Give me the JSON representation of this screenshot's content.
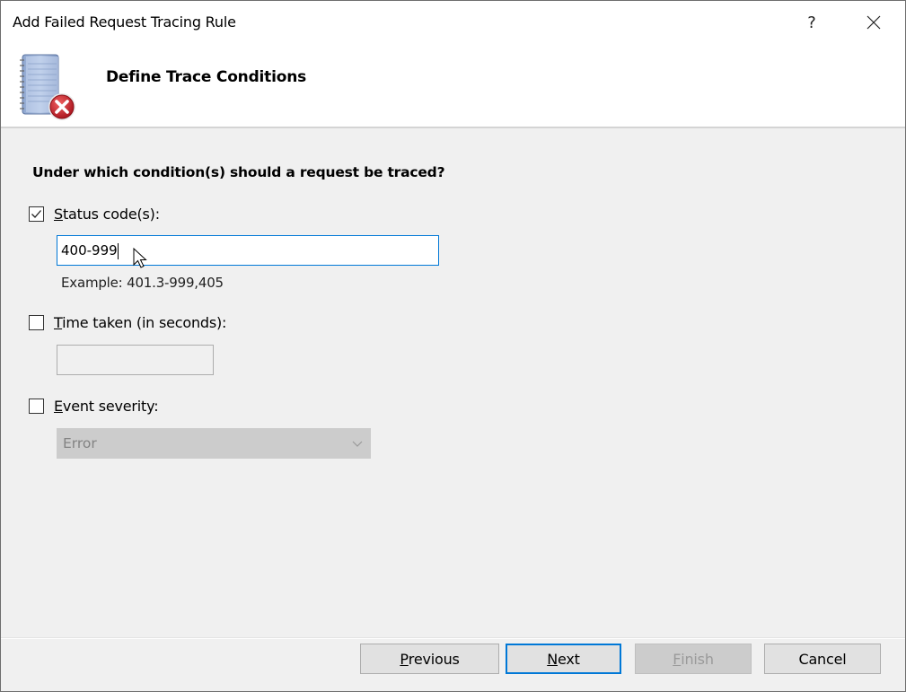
{
  "window": {
    "title": "Add Failed Request Tracing Rule",
    "help_label": "?",
    "close_label": "×"
  },
  "header": {
    "icon": "trace-log-error-icon",
    "title": "Define Trace Conditions"
  },
  "form": {
    "question": "Under which condition(s) should a request be traced?",
    "status_code": {
      "checked": true,
      "label_mnemonic": "S",
      "label_rest": "tatus code(s):",
      "value": "400-999",
      "example": "Example: 401.3-999,405"
    },
    "time_taken": {
      "checked": false,
      "label_mnemonic": "T",
      "label_rest": "ime taken (in seconds):",
      "value": ""
    },
    "event_severity": {
      "checked": false,
      "label_mnemonic": "E",
      "label_rest": "vent severity:",
      "selected": "Error"
    }
  },
  "buttons": {
    "previous": {
      "mnemonic": "P",
      "rest": "revious"
    },
    "next": {
      "mnemonic": "N",
      "rest": "ext"
    },
    "finish": {
      "mnemonic": "F",
      "rest": "inish"
    },
    "cancel": {
      "label": "Cancel"
    }
  },
  "colors": {
    "accent": "#0078d7",
    "error_badge": "#c8202a"
  }
}
